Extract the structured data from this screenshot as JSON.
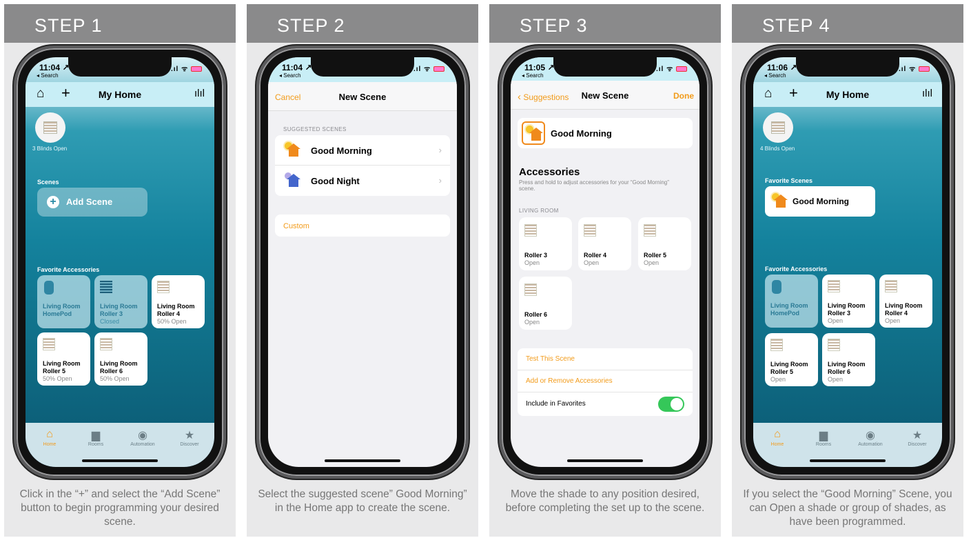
{
  "steps": [
    {
      "title": "STEP 1",
      "caption": "Click in the “+” and select the “Add Scene” button to begin programming your desired scene."
    },
    {
      "title": "STEP 2",
      "caption": "Select the suggested scene” Good Morning” in the Home app to create the scene."
    },
    {
      "title": "STEP 3",
      "caption": "Move the shade to any position desired, before completing the set up to the scene."
    },
    {
      "title": "STEP 4",
      "caption": "If you select the “Good Morning” Scene, you can Open a shade or group of shades, as have been programmed."
    }
  ],
  "status": {
    "back": "◂ Search",
    "t1": "11:04 ↗",
    "t2": "11:04 ↗",
    "t3": "11:05 ↗",
    "t4": "11:06 ↗"
  },
  "s1": {
    "title": "My Home",
    "blinds": "3 Blinds Open",
    "scenes_header": "Scenes",
    "add_scene": "Add Scene",
    "fav_header": "Favorite Accessories",
    "tiles": [
      {
        "name": "Living Room HomePod",
        "state": ""
      },
      {
        "name": "Living Room Roller 3",
        "state": "Closed"
      },
      {
        "name": "Living Room Roller 4",
        "state": "50% Open"
      },
      {
        "name": "Living Room Roller 5",
        "state": "50% Open"
      },
      {
        "name": "Living Room Roller 6",
        "state": "50% Open"
      }
    ]
  },
  "tabs": {
    "home": "Home",
    "rooms": "Rooms",
    "automation": "Automation",
    "discover": "Discover"
  },
  "s2": {
    "cancel": "Cancel",
    "title": "New Scene",
    "suggested": "SUGGESTED SCENES",
    "morning": "Good Morning",
    "night": "Good Night",
    "custom": "Custom"
  },
  "s3": {
    "back": "Suggestions",
    "title": "New Scene",
    "done": "Done",
    "scene": "Good Morning",
    "acc_title": "Accessories",
    "acc_desc": "Press and hold to adjust accessories for your “Good Morning” scene.",
    "room": "LIVING ROOM",
    "tiles": [
      {
        "name": "Roller 3",
        "state": "Open"
      },
      {
        "name": "Roller 4",
        "state": "Open"
      },
      {
        "name": "Roller 5",
        "state": "Open"
      },
      {
        "name": "Roller 6",
        "state": "Open"
      }
    ],
    "test": "Test This Scene",
    "addremove": "Add or Remove Accessories",
    "fav": "Include in Favorites"
  },
  "s4": {
    "title": "My Home",
    "blinds": "4 Blinds Open",
    "fav_scenes": "Favorite Scenes",
    "scene": "Good Morning",
    "fav_header": "Favorite Accessories",
    "tiles": [
      {
        "name": "Living Room HomePod",
        "state": ""
      },
      {
        "name": "Living Room Roller 3",
        "state": "Open"
      },
      {
        "name": "Living Room Roller 4",
        "state": "Open"
      },
      {
        "name": "Living Room Roller 5",
        "state": "Open"
      },
      {
        "name": "Living Room Roller 6",
        "state": "Open"
      }
    ]
  }
}
